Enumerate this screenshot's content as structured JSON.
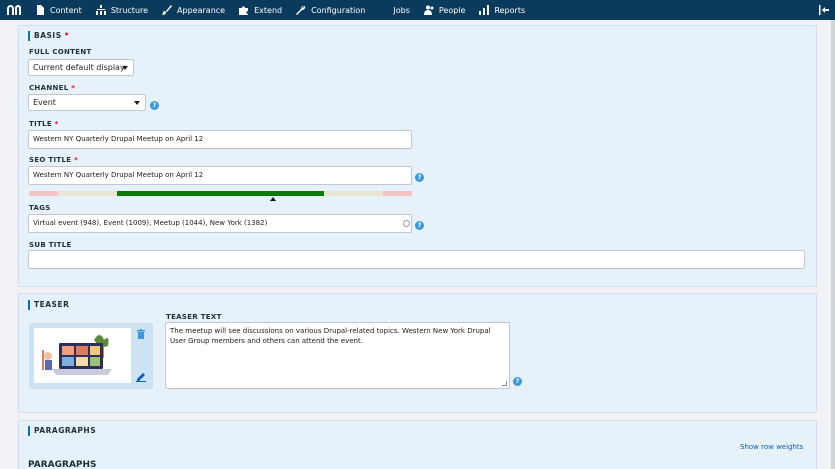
{
  "toolbar": {
    "items": [
      {
        "label": "Content",
        "icon": "file-icon"
      },
      {
        "label": "Structure",
        "icon": "sitemap-icon"
      },
      {
        "label": "Appearance",
        "icon": "paintbrush-icon"
      },
      {
        "label": "Extend",
        "icon": "puzzle-icon"
      },
      {
        "label": "Configuration",
        "icon": "wrench-icon"
      },
      {
        "label": "Jobs",
        "icon": ""
      },
      {
        "label": "People",
        "icon": "people-icon"
      },
      {
        "label": "Reports",
        "icon": "bar-chart-icon"
      }
    ]
  },
  "basis": {
    "title": "BASIS",
    "required_mark": "*",
    "full_content": {
      "label": "FULL CONTENT",
      "value": "Current default display"
    },
    "channel": {
      "label": "CHANNEL",
      "value": "Event"
    },
    "title_field": {
      "label": "TITLE",
      "value": "Western NY Quarterly Drupal Meetup on April 12"
    },
    "seo_title": {
      "label": "SEO TITLE",
      "value": "Western NY Quarterly Drupal Meetup on April 12"
    },
    "seo_score": {
      "segments": [
        {
          "color": "#f2c4c4",
          "fraction": 0.075
        },
        {
          "color": "#e8e6d2",
          "fraction": 0.155
        },
        {
          "color": "#0b7a0b",
          "fraction": 0.54
        },
        {
          "color": "#e8e6d2",
          "fraction": 0.155
        },
        {
          "color": "#f2c4c4",
          "fraction": 0.075
        }
      ]
    },
    "tags": {
      "label": "TAGS",
      "value": "Virtual event (948), Event (1009), Meetup (1044), New York (1382)"
    },
    "sub_title": {
      "label": "SUB TITLE",
      "value": ""
    },
    "help_glyph": "?"
  },
  "teaser": {
    "title": "TEASER",
    "text_label": "TEASER TEXT",
    "text_value": "The meetup will see discussions on various Drupal-related topics. Western New York Drupal User Group members and others can attend the event."
  },
  "paragraphs": {
    "title": "PARAGRAPHS",
    "show_row_weights": "Show row weights",
    "sub_heading": "PARAGRAPHS"
  },
  "colors": {
    "toolbar": "#0b3b5c",
    "accent": "#0077c0",
    "panel": "#e7f1fa",
    "link": "#0d5fb3"
  }
}
